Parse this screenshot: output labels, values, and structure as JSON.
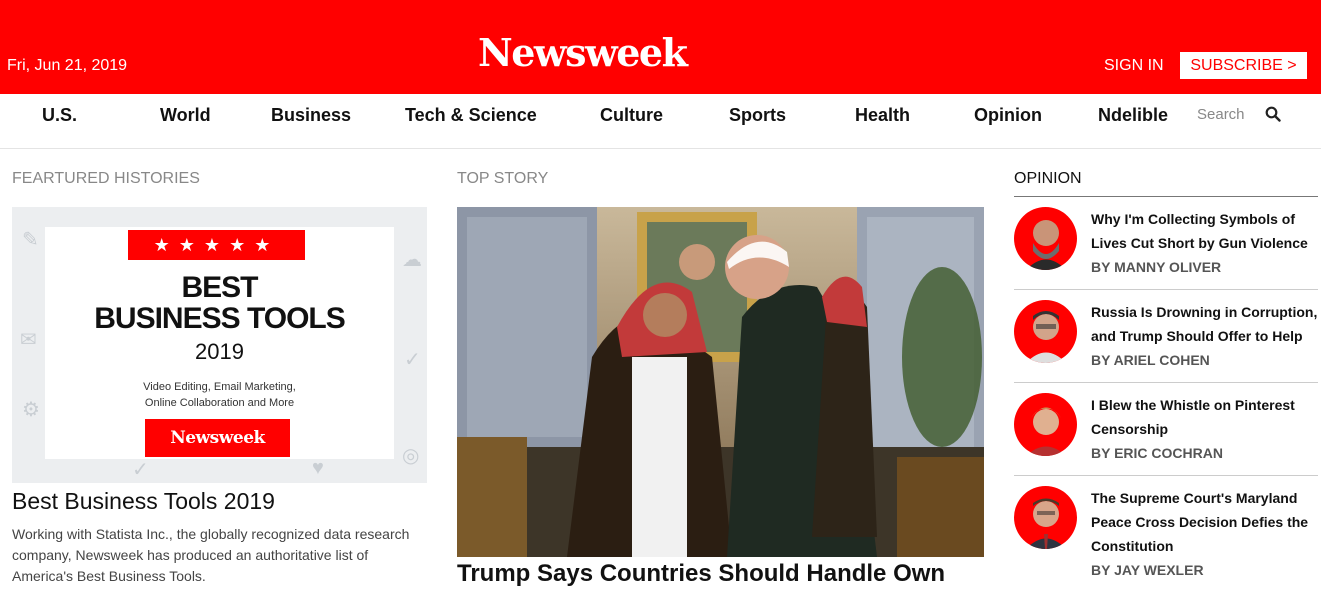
{
  "header": {
    "date": "Fri, Jun 21, 2019",
    "logo": "Newsweek",
    "sign_in": "SIGN IN",
    "subscribe": "SUBSCRIBE >",
    "brand_color": "#ff0000"
  },
  "nav": {
    "items": [
      "U.S.",
      "World",
      "Business",
      "Tech & Science",
      "Culture",
      "Sports",
      "Health",
      "Opinion",
      "Ndelible"
    ],
    "search_label": "Search",
    "search_icon": "magnifier-icon"
  },
  "featured": {
    "heading": "FEARTURED HISTORIES",
    "image": {
      "stars": "★★★★★",
      "line1": "BEST",
      "line2": "BUSINESS TOOLS",
      "year": "2019",
      "sub1": "Video Editing, Email Marketing,",
      "sub2": "Online Collaboration and More",
      "badge": "Newsweek"
    },
    "title": "Best Business Tools 2019",
    "description": "Working with Statista Inc., the globally recognized data research company, Newsweek has produced an authoritative list of America's Best Business Tools."
  },
  "top_story": {
    "heading": "TOP STORY",
    "title": "Trump Says Countries Should Handle Own"
  },
  "opinion": {
    "heading": "OPINION",
    "items": [
      {
        "title": "Why I'm Collecting Symbols of Lives Cut Short by Gun Violence",
        "byline": "BY MANNY OLIVER"
      },
      {
        "title": "Russia Is Drowning in Corruption, and Trump Should Offer to Help",
        "byline": "BY ARIEL COHEN"
      },
      {
        "title": "I Blew the Whistle on Pinterest Censorship",
        "byline": "BY ERIC COCHRAN"
      },
      {
        "title": "The Supreme Court's Maryland Peace Cross Decision Defies the Constitution",
        "byline": "BY JAY WEXLER"
      }
    ]
  }
}
